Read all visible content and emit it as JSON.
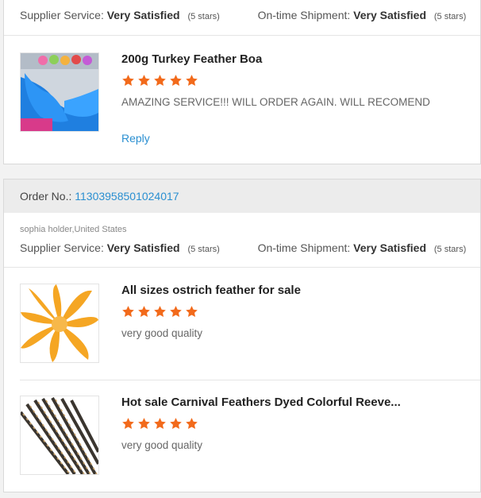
{
  "card1": {
    "supplier_label": "Supplier Service:",
    "supplier_value": "Very Satisfied",
    "supplier_stars": "(5 stars)",
    "shipment_label": "On-time Shipment:",
    "shipment_value": "Very Satisfied",
    "shipment_stars": "(5 stars)",
    "product": {
      "title": "200g Turkey Feather Boa",
      "rating": 5,
      "comment": "AMAZING SERVICE!!! WILL ORDER AGAIN.   WILL RECOMEND",
      "reply": "Reply"
    }
  },
  "card2": {
    "order_label": "Order No.:",
    "order_number": "11303958501024017",
    "buyer": "sophia holder,United States",
    "supplier_label": "Supplier Service:",
    "supplier_value": "Very Satisfied",
    "supplier_stars": "(5 stars)",
    "shipment_label": "On-time Shipment:",
    "shipment_value": "Very Satisfied",
    "shipment_stars": "(5 stars)",
    "products": [
      {
        "title": "All sizes ostrich feather for sale",
        "rating": 5,
        "comment": "very good quality"
      },
      {
        "title": "Hot sale Carnival Feathers Dyed Colorful Reeve...",
        "rating": 5,
        "comment": "very good quality"
      }
    ]
  },
  "colors": {
    "star": "#f26a1b",
    "link": "#2a8fd1"
  },
  "icons": {
    "star": "star-icon"
  }
}
